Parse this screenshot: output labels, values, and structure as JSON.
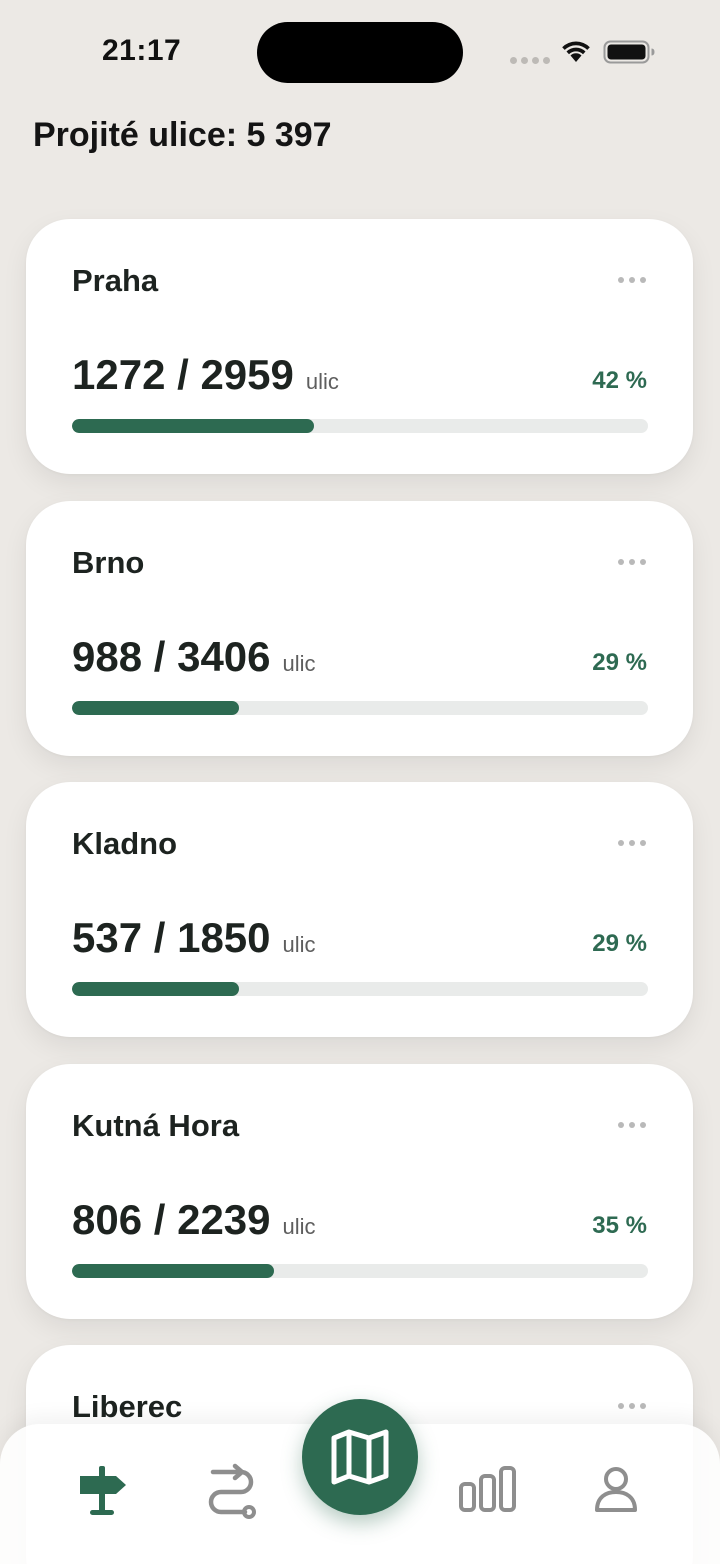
{
  "status_bar": {
    "time": "21:17"
  },
  "header": {
    "title": "Projité ulice: 5 397"
  },
  "cards": [
    {
      "name": "Praha",
      "count": "1272 / 2959",
      "unit": "ulic",
      "percent_label": "42 %",
      "progress": 0.42
    },
    {
      "name": "Brno",
      "count": "988 / 3406",
      "unit": "ulic",
      "percent_label": "29 %",
      "progress": 0.29
    },
    {
      "name": "Kladno",
      "count": "537 / 1850",
      "unit": "ulic",
      "percent_label": "29 %",
      "progress": 0.29
    },
    {
      "name": "Kutná Hora",
      "count": "806 / 2239",
      "unit": "ulic",
      "percent_label": "35 %",
      "progress": 0.35
    },
    {
      "name": "Liberec",
      "count": "",
      "unit": "",
      "percent_label": "",
      "progress": null
    }
  ],
  "tab_bar": {
    "items": [
      {
        "icon": "signpost-icon",
        "active": true
      },
      {
        "icon": "route-icon",
        "active": false
      },
      {
        "icon": "map-icon",
        "active": false,
        "featured": true
      },
      {
        "icon": "bar-chart-icon",
        "active": false
      },
      {
        "icon": "profile-icon",
        "active": false
      }
    ]
  },
  "colors": {
    "accent": "#2d6a51",
    "background": "#ece9e5",
    "track": "#e9ebea",
    "inactive_icon": "#8e8e8e"
  }
}
